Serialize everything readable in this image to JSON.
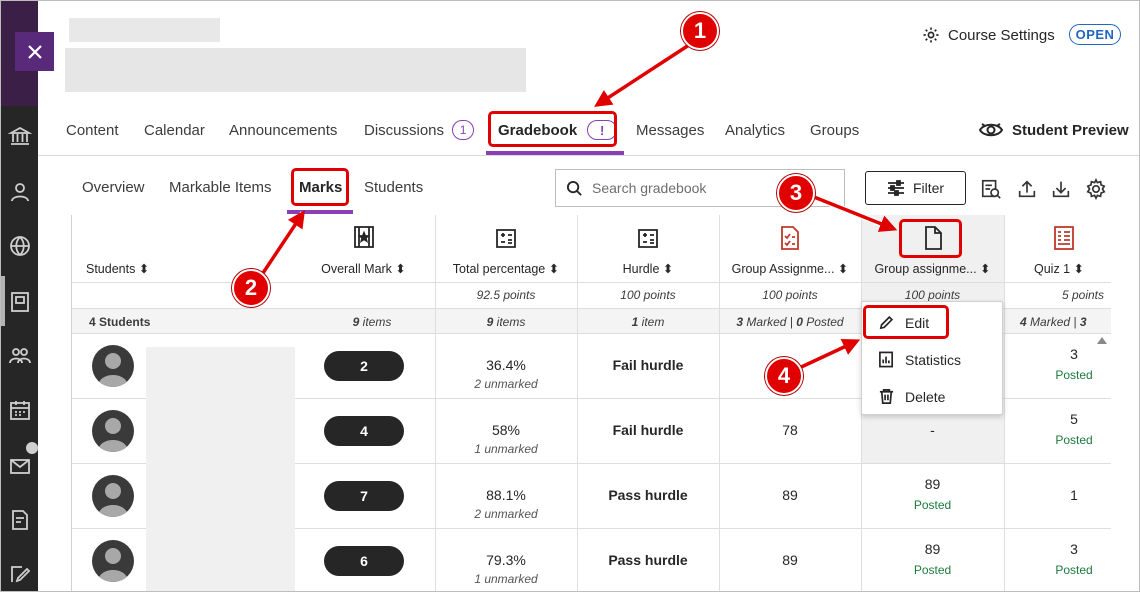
{
  "header": {
    "course_settings_label": "Course Settings",
    "open_label": "OPEN"
  },
  "main_nav": {
    "items": [
      "Content",
      "Calendar",
      "Announcements",
      "Discussions",
      "Gradebook",
      "Messages",
      "Analytics",
      "Groups"
    ],
    "discussions_count": "1",
    "gradebook_alert": "!",
    "active": "Gradebook",
    "student_preview_label": "Student Preview"
  },
  "sub_nav": {
    "items": [
      "Overview",
      "Markable Items",
      "Marks",
      "Students"
    ],
    "active": "Marks"
  },
  "search": {
    "placeholder": "Search gradebook"
  },
  "filter_label": "Filter",
  "grid": {
    "columns": [
      {
        "label": "Students",
        "points": "",
        "summary": "4 Students"
      },
      {
        "label": "Overall Mark",
        "points": "",
        "summary": "9 items"
      },
      {
        "label": "Total percentage",
        "points": "92.5 points",
        "summary": "9 items"
      },
      {
        "label": "Hurdle",
        "points": "100 points",
        "summary": "1 item"
      },
      {
        "label": "Group Assignme...",
        "points": "100 points",
        "summary": "3 Marked | 0 Posted"
      },
      {
        "label": "Group assignme...",
        "points": "100 points",
        "summary": ""
      },
      {
        "label": "Quiz 1",
        "points": "5 points",
        "summary": "4 Marked | 3"
      }
    ],
    "summary_parts": {
      "students_count": "4",
      "students_word": "Students",
      "overall_n": "9",
      "overall_word": "items",
      "total_n": "9",
      "total_word": "items",
      "hurdle_n": "1",
      "hurdle_word": "item",
      "ga_marked_n": "3",
      "ga_marked_word": "Marked |",
      "ga_posted_n": "0",
      "ga_posted_word": "Posted",
      "quiz_marked_n": "4",
      "quiz_marked_word": "Marked |",
      "quiz_extra": "3"
    },
    "rows": [
      {
        "overall": "2",
        "percentage": "36.4%",
        "unmarked": "2 unmarked",
        "hurdle": "Fail hurdle",
        "group_a": "",
        "group_b": "",
        "group_b_status": "",
        "quiz": "3",
        "quiz_status": "Posted"
      },
      {
        "overall": "4",
        "percentage": "58%",
        "unmarked": "1 unmarked",
        "hurdle": "Fail hurdle",
        "group_a": "78",
        "group_b": "-",
        "group_b_status": "",
        "quiz": "5",
        "quiz_status": "Posted"
      },
      {
        "overall": "7",
        "percentage": "88.1%",
        "unmarked": "2 unmarked",
        "hurdle": "Pass hurdle",
        "group_a": "89",
        "group_b": "89",
        "group_b_status": "Posted",
        "quiz": "1",
        "quiz_status": ""
      },
      {
        "overall": "6",
        "percentage": "79.3%",
        "unmarked": "1 unmarked",
        "hurdle": "Pass hurdle",
        "group_a": "89",
        "group_b": "89",
        "group_b_status": "Posted",
        "quiz": "3",
        "quiz_status": "Posted"
      }
    ]
  },
  "context_menu": {
    "items": [
      "Edit",
      "Statistics",
      "Delete"
    ]
  },
  "callouts": [
    "1",
    "2",
    "3",
    "4"
  ],
  "colors": {
    "accent_purple": "#8a3fb5",
    "open_blue": "#2166c0",
    "posted_green": "#1d7a3c",
    "annotation_red": "#e00000",
    "rail_dark": "#262626"
  },
  "icons": {
    "rail": [
      "institution-icon",
      "profile-icon",
      "globe-icon",
      "courses-icon",
      "groups-icon",
      "calendar-icon",
      "messages-icon",
      "grades-icon",
      "tools-icon"
    ],
    "toolbar": [
      "grade-report-icon",
      "upload-icon",
      "download-icon",
      "settings-gear-icon"
    ]
  }
}
